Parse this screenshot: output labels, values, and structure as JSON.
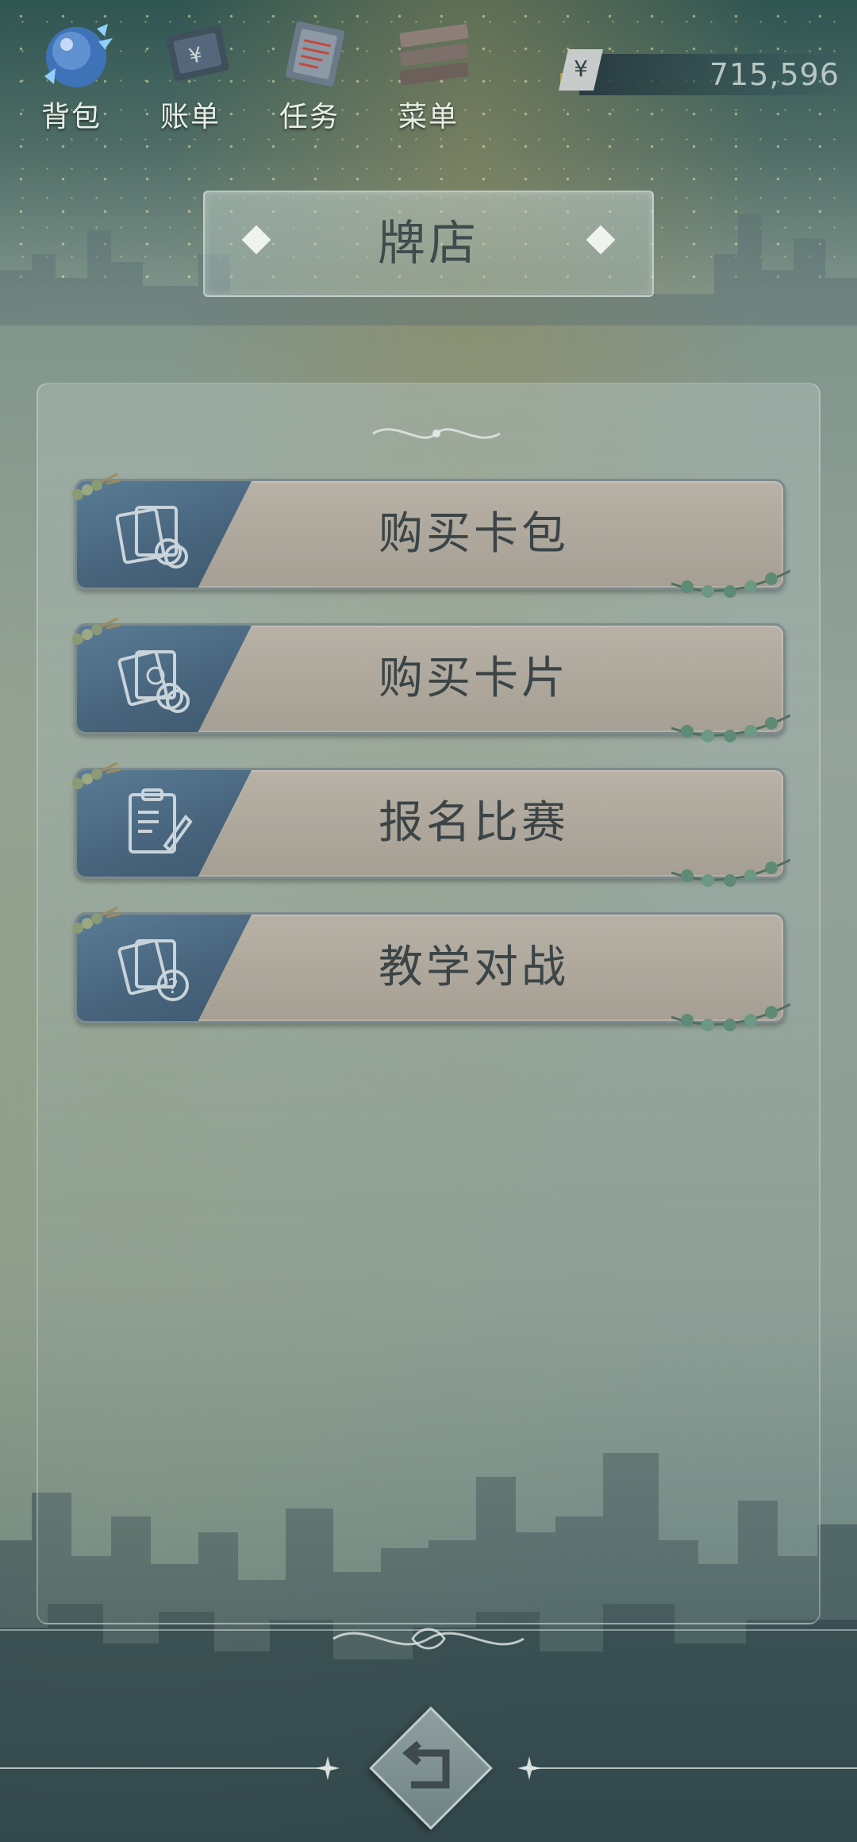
{
  "topnav": {
    "items": [
      {
        "label": "背包",
        "icon": "backpack-orb-icon"
      },
      {
        "label": "账单",
        "icon": "bill-icon"
      },
      {
        "label": "任务",
        "icon": "task-icon"
      },
      {
        "label": "菜单",
        "icon": "menu-icon"
      }
    ]
  },
  "money": {
    "symbol": "¥",
    "value": "715,596"
  },
  "title": "牌店",
  "menu": {
    "items": [
      {
        "label": "购买卡包",
        "icon": "card-pack-icon"
      },
      {
        "label": "购买卡片",
        "icon": "cards-coins-icon"
      },
      {
        "label": "报名比赛",
        "icon": "clipboard-pen-icon"
      },
      {
        "label": "教学对战",
        "icon": "cards-question-icon"
      }
    ]
  },
  "colors": {
    "accent_blue": "#4f6f88",
    "button_face": "#b2aba0",
    "text_dark": "#3b4446"
  }
}
